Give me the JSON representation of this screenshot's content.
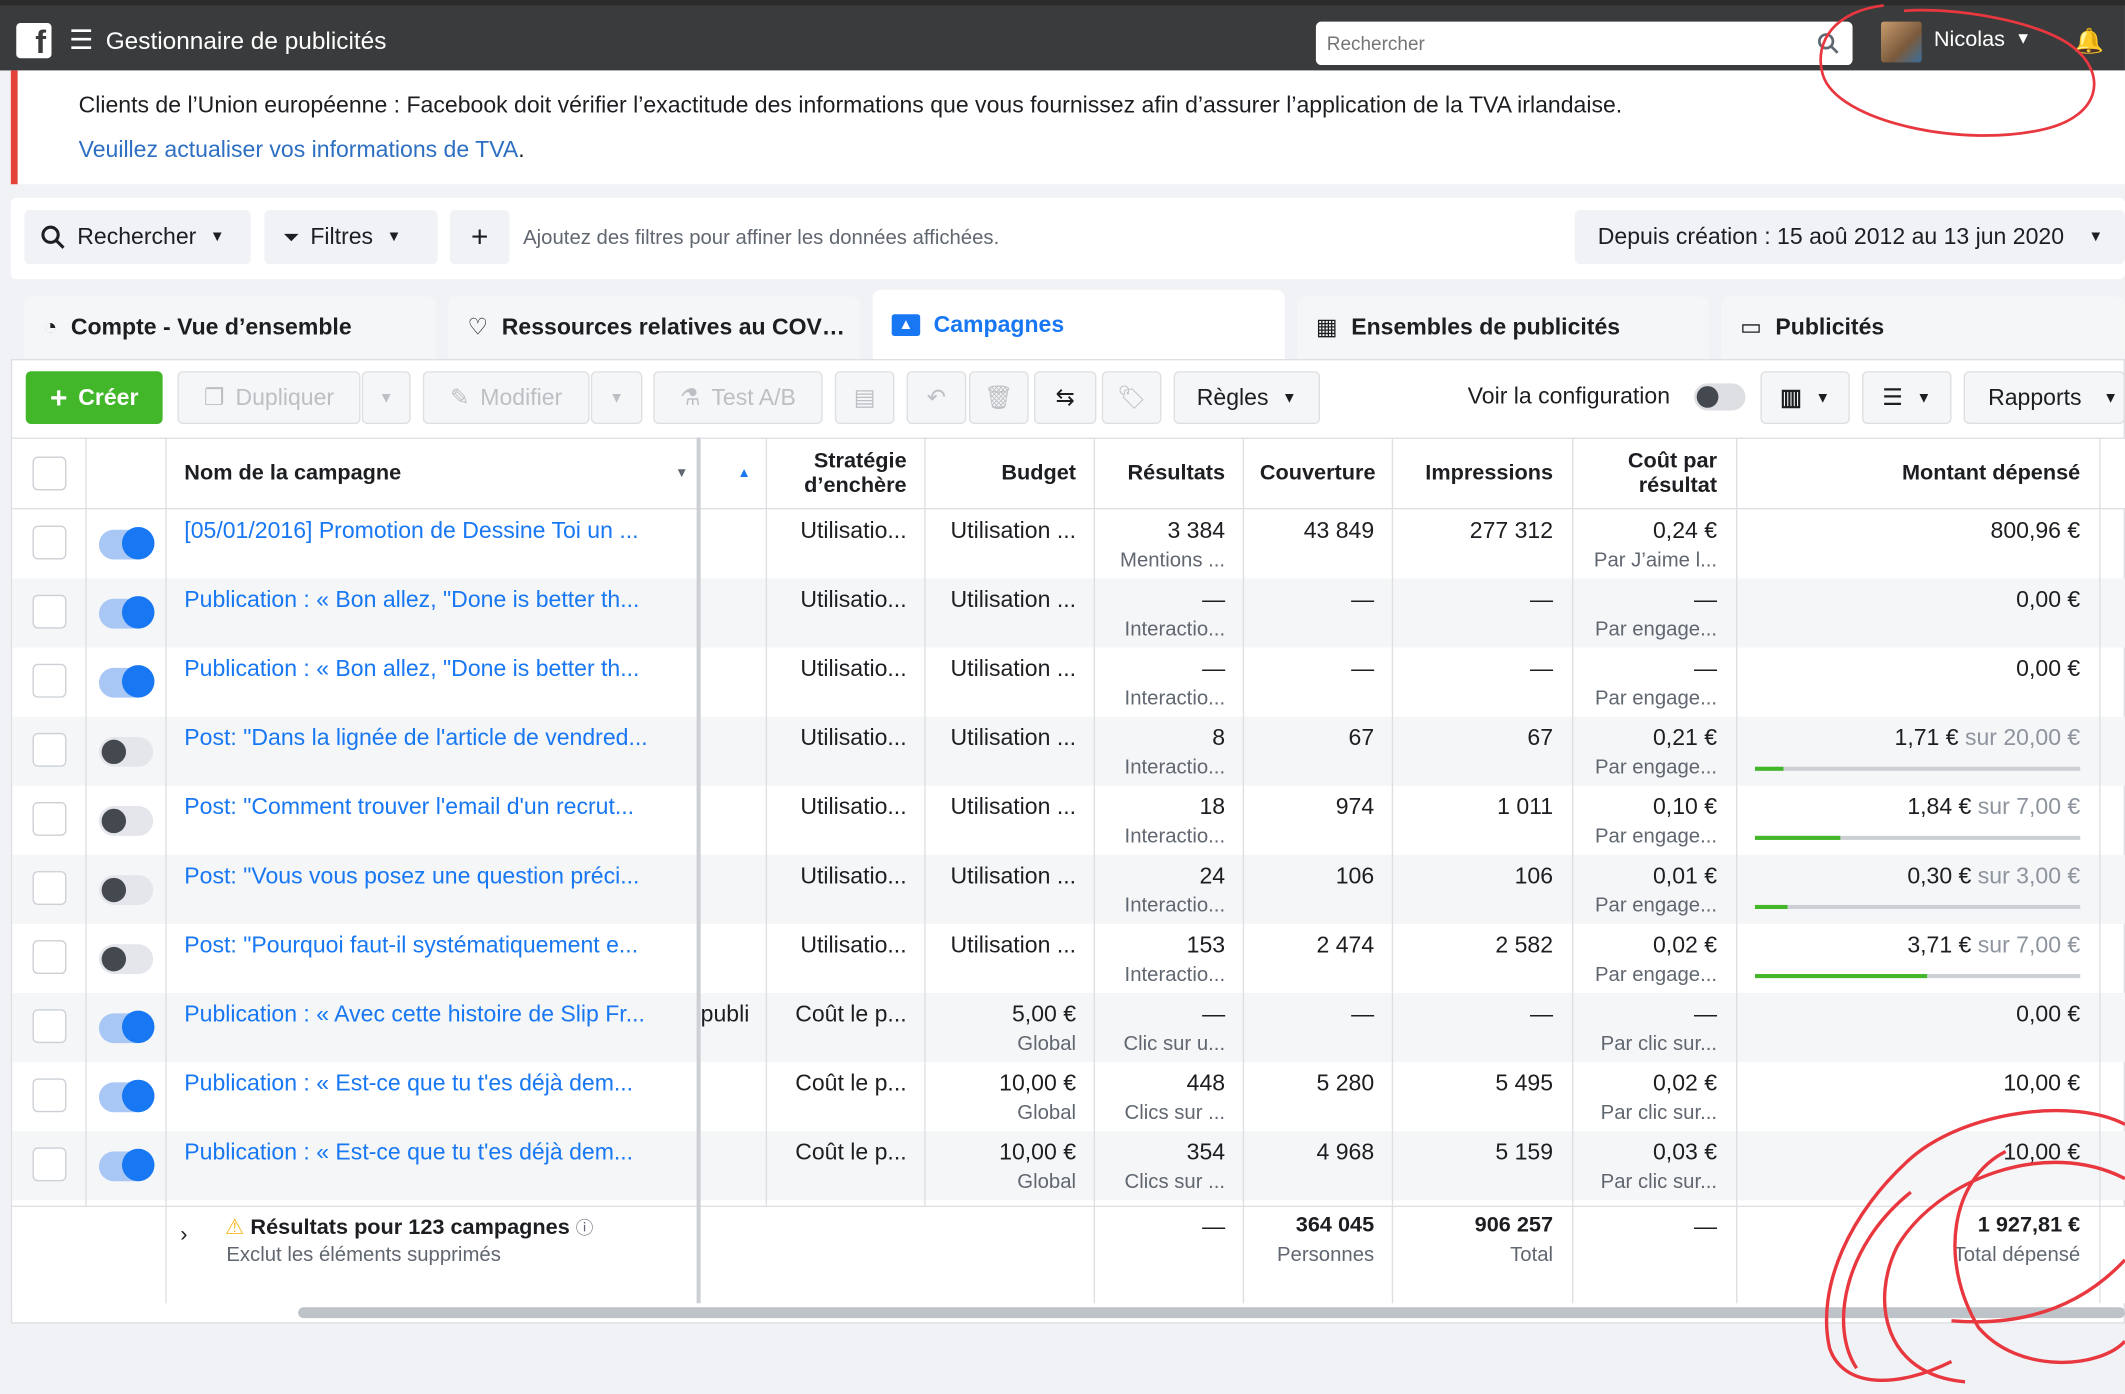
{
  "topbar": {
    "app_title": "Gestionnaire de publicités",
    "search_placeholder": "Rechercher",
    "user_name": "Nicolas"
  },
  "notice": {
    "text": "Clients de l’Union européenne : Facebook doit vérifier l’exactitude des informations que vous fournissez afin d’assurer l’application de la TVA irlandaise.",
    "link": "Veuillez actualiser vos informations de TVA",
    "link_suffix": "."
  },
  "filters": {
    "search_label": "Rechercher",
    "filters_label": "Filtres",
    "add_symbol": "+",
    "hint": "Ajoutez des filtres pour affiner les données affichées.",
    "date_range": "Depuis création : 15 aoû 2012 au 13 jun 2020"
  },
  "tabs": [
    {
      "label": "Compte - Vue d’ensemble",
      "icon": "gauge-icon"
    },
    {
      "label": "Ressources relatives au COV…",
      "icon": "heart-hands-icon"
    },
    {
      "label": "Campagnes",
      "icon": "folder-icon"
    },
    {
      "label": "Ensembles de publicités",
      "icon": "grid-icon"
    },
    {
      "label": "Publicités",
      "icon": "ad-frame-icon"
    }
  ],
  "toolbar": {
    "create": "Créer",
    "duplicate": "Dupliquer",
    "edit": "Modifier",
    "ab_test": "Test A/B",
    "rules": "Règles",
    "config": "Voir la configuration",
    "reports": "Rapports"
  },
  "columns": {
    "name": "Nom de la campagne",
    "bid_strategy_1": "Stratégie",
    "bid_strategy_2": "d’enchère",
    "budget": "Budget",
    "results": "Résultats",
    "reach": "Couverture",
    "impressions": "Impressions",
    "cpr_1": "Coût par",
    "cpr_2": "résultat",
    "spent": "Montant dépensé"
  },
  "rows": [
    {
      "active": true,
      "name": "[05/01/2016] Promotion de Dessine Toi un ...",
      "delivery": "",
      "bid": "Utilisatio...",
      "budget": "Utilisation ...",
      "budget_sub": "",
      "results": "3 384",
      "results_sub": "Mentions ...",
      "reach": "43 849",
      "impressions": "277 312",
      "cpr": "0,24 €",
      "cpr_sub": "Par J’aime l...",
      "spent": "800,96 €",
      "spent_limit": "",
      "progress": null
    },
    {
      "active": true,
      "name": "Publication : « Bon allez, \"Done is better th...",
      "delivery": "",
      "bid": "Utilisatio...",
      "budget": "Utilisation ...",
      "budget_sub": "",
      "results": "—",
      "results_sub": "Interactio...",
      "reach": "—",
      "impressions": "—",
      "cpr": "—",
      "cpr_sub": "Par engage...",
      "spent": "0,00 €",
      "spent_limit": "",
      "progress": null
    },
    {
      "active": true,
      "name": "Publication : « Bon allez, \"Done is better th...",
      "delivery": "",
      "bid": "Utilisatio...",
      "budget": "Utilisation ...",
      "budget_sub": "",
      "results": "—",
      "results_sub": "Interactio...",
      "reach": "—",
      "impressions": "—",
      "cpr": "—",
      "cpr_sub": "Par engage...",
      "spent": "0,00 €",
      "spent_limit": "",
      "progress": null
    },
    {
      "active": false,
      "name": "Post: \"Dans la lignée de l'article de vendred...",
      "delivery": "",
      "bid": "Utilisatio...",
      "budget": "Utilisation ...",
      "budget_sub": "",
      "results": "8",
      "results_sub": "Interactio...",
      "reach": "67",
      "impressions": "67",
      "cpr": "0,21 €",
      "cpr_sub": "Par engage...",
      "spent": "1,71 €",
      "spent_limit": " sur 20,00 €",
      "progress": 0.0855
    },
    {
      "active": false,
      "name": "Post: \"Comment trouver l'email d'un recrut...",
      "delivery": "",
      "bid": "Utilisatio...",
      "budget": "Utilisation ...",
      "budget_sub": "",
      "results": "18",
      "results_sub": "Interactio...",
      "reach": "974",
      "impressions": "1 011",
      "cpr": "0,10 €",
      "cpr_sub": "Par engage...",
      "spent": "1,84 €",
      "spent_limit": " sur 7,00 €",
      "progress": 0.263
    },
    {
      "active": false,
      "name": "Post: \"Vous vous posez une question préci...",
      "delivery": "",
      "bid": "Utilisatio...",
      "budget": "Utilisation ...",
      "budget_sub": "",
      "results": "24",
      "results_sub": "Interactio...",
      "reach": "106",
      "impressions": "106",
      "cpr": "0,01 €",
      "cpr_sub": "Par engage...",
      "spent": "0,30 €",
      "spent_limit": " sur 3,00 €",
      "progress": 0.1
    },
    {
      "active": false,
      "name": "Post: \"Pourquoi faut-il systématiquement e...",
      "delivery": "",
      "bid": "Utilisatio...",
      "budget": "Utilisation ...",
      "budget_sub": "",
      "results": "153",
      "results_sub": "Interactio...",
      "reach": "2 474",
      "impressions": "2 582",
      "cpr": "0,02 €",
      "cpr_sub": "Par engage...",
      "spent": "3,71 €",
      "spent_limit": " sur 7,00 €",
      "progress": 0.53
    },
    {
      "active": true,
      "name": "Publication : « Avec cette histoire de Slip Fr...",
      "delivery": "publi",
      "bid": "Coût le p...",
      "budget": "5,00 €",
      "budget_sub": "Global",
      "results": "—",
      "results_sub": "Clic sur u...",
      "reach": "—",
      "impressions": "—",
      "cpr": "—",
      "cpr_sub": "Par clic sur...",
      "spent": "0,00 €",
      "spent_limit": "",
      "progress": null
    },
    {
      "active": true,
      "name": "Publication : « Est-ce que tu t'es déjà dem...",
      "delivery": "",
      "bid": "Coût le p...",
      "budget": "10,00 €",
      "budget_sub": "Global",
      "results": "448",
      "results_sub": "Clics sur ...",
      "reach": "5 280",
      "impressions": "5 495",
      "cpr": "0,02 €",
      "cpr_sub": "Par clic sur...",
      "spent": "10,00 €",
      "spent_limit": "",
      "progress": null
    },
    {
      "active": true,
      "name": "Publication : « Est-ce que tu t'es déjà dem...",
      "delivery": "",
      "bid": "Coût le p...",
      "budget": "10,00 €",
      "budget_sub": "Global",
      "results": "354",
      "results_sub": "Clics sur ...",
      "reach": "4 968",
      "impressions": "5 159",
      "cpr": "0,03 €",
      "cpr_sub": "Par clic sur...",
      "spent": "10,00 €",
      "spent_limit": "",
      "progress": null
    }
  ],
  "totals": {
    "label": "Résultats pour 123 campagnes",
    "sublabel": "Exclut les éléments supprimés",
    "results": "—",
    "reach": "364 045",
    "reach_sub": "Personnes",
    "impressions": "906 257",
    "impressions_sub": "Total",
    "cpr": "—",
    "spent": "1 927,81 €",
    "spent_sub": "Total dépensé"
  },
  "colors": {
    "accent": "#1877f2",
    "create": "#42b72a",
    "annotation": "#e8373e"
  }
}
